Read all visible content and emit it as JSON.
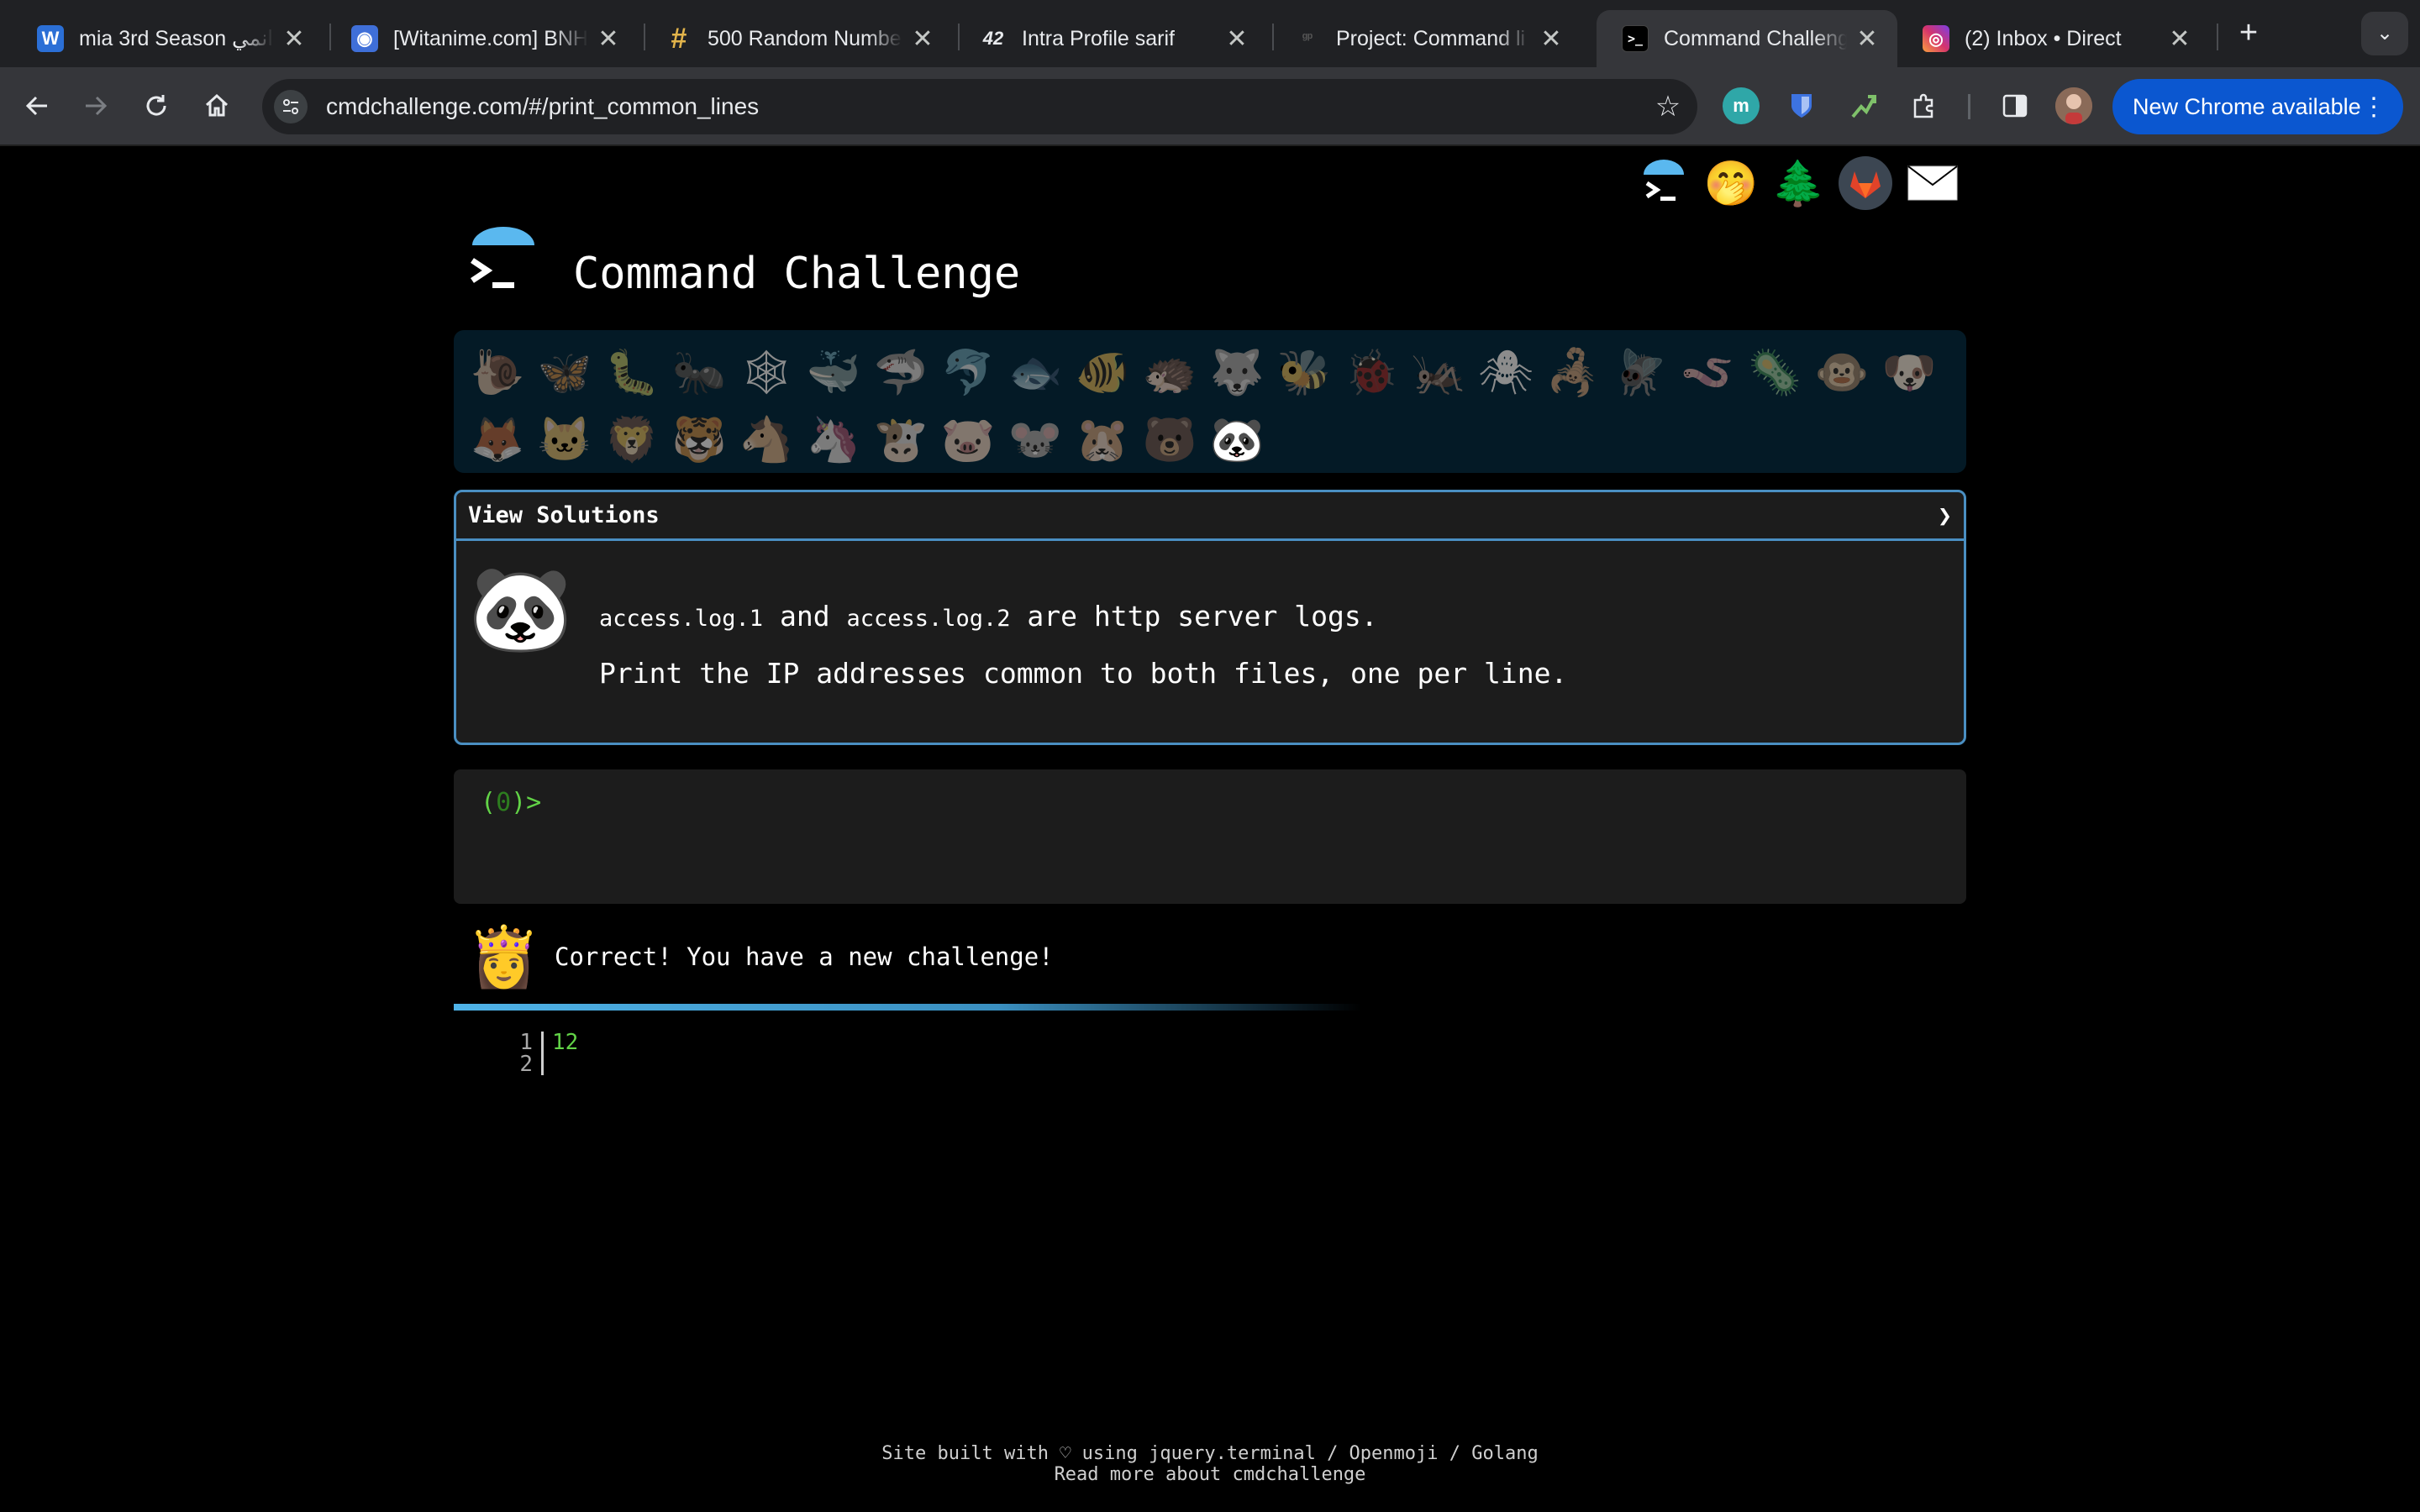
{
  "browser": {
    "tabs": [
      {
        "title": "mia 3rd Season انمي",
        "favicon": "W",
        "favicon_color": "#2b6fd6",
        "close": "✕"
      },
      {
        "title": "[Witanime.com] BNH",
        "favicon": "◉",
        "favicon_color": "#3f6fd8",
        "close": "✕"
      },
      {
        "title": "500 Random Numbe",
        "favicon": "#",
        "favicon_color": "#e2b44b",
        "close": "✕"
      },
      {
        "title": "Intra Profile sarif",
        "favicon": "42",
        "favicon_color": "#202124",
        "close": "✕"
      },
      {
        "title": "Project: Command li",
        "favicon": "ᵍᵖ",
        "favicon_color": "#202124",
        "close": "✕"
      },
      {
        "title": "Command Challenge",
        "favicon": ">_",
        "favicon_color": "#000000",
        "close": "✕"
      },
      {
        "title": "(2) Inbox • Direct",
        "favicon": "◎",
        "favicon_color": "#d6336c",
        "close": "✕"
      }
    ],
    "new_tab": "+",
    "tab_search": "⌄",
    "url": "cmdchallenge.com/#/print_common_lines",
    "update_button": "New Chrome available",
    "update_menu": "⋮"
  },
  "header": {
    "title": "Command Challenge",
    "top_links": [
      {
        "name": "terminal-link-icon",
        "glyph": "▶"
      },
      {
        "name": "hint-emoji-icon",
        "glyph": "🤭"
      },
      {
        "name": "tree-icon",
        "glyph": "🌲"
      },
      {
        "name": "gitlab-icon",
        "glyph": "🦊"
      },
      {
        "name": "email-icon",
        "glyph": "✉"
      }
    ]
  },
  "challenges": {
    "row1": [
      "🐌",
      "🦋",
      "🐛",
      "🐜",
      "🕸",
      "🐳",
      "🦈",
      "🐬",
      "🐟",
      "🐠",
      "🦔",
      "🐺",
      "🐝",
      "🐞",
      "🦗",
      "🕷",
      "🦂",
      "🪰",
      "🪱",
      "🦠",
      "🐵",
      "🐶"
    ],
    "row2": [
      "🦊",
      "🐱",
      "🦁",
      "🐯",
      "🐴",
      "🦄",
      "🐮",
      "🐷",
      "🐭",
      "🐹",
      "🐻",
      "🐼"
    ]
  },
  "challenge": {
    "solutions_label": "View Solutions",
    "chevron": "❯",
    "emoji": "🐼",
    "file1": "access.log.1",
    "and": "and",
    "file2": "access.log.2",
    "rest": "are http server logs.",
    "line2": "Print the IP addresses common to both files, one per line."
  },
  "terminal": {
    "prompt_open": "(",
    "exit_code": "0",
    "prompt_close": ")>"
  },
  "result": {
    "emoji": "👸",
    "message": "Correct! You have a new challenge!",
    "progress": 0.6
  },
  "output": {
    "lines": [
      {
        "n": "1",
        "text": "12"
      },
      {
        "n": "2",
        "text": ""
      }
    ]
  },
  "footer": {
    "line1": "Site built with ♡ using jquery.terminal / Openmoji / Golang",
    "line2": "Read more about cmdchallenge"
  }
}
